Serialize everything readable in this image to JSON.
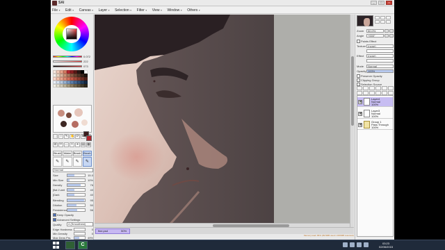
{
  "app": {
    "title": "SAI",
    "window_buttons": [
      "_",
      "□",
      "×"
    ]
  },
  "menubar": {
    "items": [
      "File",
      "Edit",
      "Canvas",
      "Layer",
      "Selection",
      "Filter",
      "View",
      "Window",
      "Others"
    ],
    "selection_label": "Selection",
    "zoom_value": "50%",
    "angle_value": "+000°",
    "stabilizer_label": "Stabilizer",
    "stabilizer_value": "7"
  },
  "color": {
    "hsv_values": [
      "0.072",
      "222",
      "073"
    ],
    "swatches": [
      "#f6e7df",
      "#f0c9b8",
      "#e8a48c",
      "#d57a62",
      "#b3262f",
      "#8a1f22",
      "#5a1a17",
      "#2b1614",
      "#000000",
      "#ffffff",
      "#f3efe8",
      "#e8d2c0",
      "#d9b39c",
      "#c99075",
      "#a9745b",
      "#8b5a44",
      "#6d4532",
      "#4f3426",
      "#362219",
      "#1d130e",
      "#f9d8cc",
      "#f3c0aa",
      "#eaa48d",
      "#df8a72",
      "#d3705c",
      "#c45a48",
      "#a94a3b",
      "#8c3b2e",
      "#6d2d23",
      "#4e2019",
      "#eaf0f7",
      "#d6e1ee",
      "#b9cbe0",
      "#98b1d0",
      "#7a97be",
      "#5d7ea9",
      "#476893",
      "#33527a",
      "#233e5f",
      "#152a44",
      "#f0eee6",
      "#e3ded0",
      "#d1c9b5",
      "#bcb299",
      "#a5987c",
      "#8d7e62",
      "#74674d",
      "#5c513b",
      "#443c2b",
      "#2e281c"
    ],
    "fg": "#3a1d1d",
    "bg": "#b3262f"
  },
  "tools": {
    "icons": [
      "⬚",
      "○",
      "✎",
      "✋",
      "⟳",
      "⊕",
      "✥",
      "⊘",
      "✂",
      "↔",
      "✧",
      "⌖",
      "▤",
      "▦"
    ],
    "brush_tabs": [
      "Brush",
      "Water",
      "Brush",
      "Brush"
    ],
    "brush_icons": [
      "✎",
      "✎",
      "✎",
      "✎"
    ]
  },
  "brush": {
    "mode": "Normal",
    "size_label": "Size",
    "size_mult": "x1.0",
    "size_value": "15.0",
    "min_size_label": "Min Size",
    "min_size_value": "10%",
    "density_label": "Density",
    "density_value": "76",
    "shape_label": "[flat 2.wet",
    "shape_value": "40",
    "texture_label": "[Dark",
    "texture_value": "40",
    "blending_label": "Blending",
    "blending_value": "95",
    "dilution_label": "Dilution",
    "dilution_value": "50",
    "persistence_label": "Persistence",
    "persistence_value": "56",
    "keep_opacity_label": "Keep Opacity",
    "advanced_label": "Advanced Settings",
    "quality_label": "Quality",
    "quality_value": "4 (Smoothest)",
    "edge_label": "Edge Hardness",
    "edge_value": "0",
    "min_density_label": "Min Density",
    "min_density_value": "0",
    "max_dens_label": "Max Dens Prs.",
    "max_dens_value": "49%",
    "hard_soft_label": "Hard <-> Soft",
    "hard_soft_value": "100"
  },
  "document": {
    "tab_label": "fine.psd",
    "tab_zoom": "50%"
  },
  "right": {
    "zoom_label": "Zoom",
    "zoom_value": "50.0%",
    "angle_label": "Angle",
    "angle_value": "+000°",
    "paint_effect": "Paints Effect",
    "texture_label": "Texture",
    "texture_value": "(none)",
    "effect_label": "Effect",
    "effect_value": "(none)",
    "mode_label": "Mode",
    "mode_value": "Normal",
    "opacity_label": "Opacity",
    "opacity_value": "100%",
    "preserve_opacity": "Preserve Opacity",
    "clipping_group": "Clipping Group",
    "selection_source": "Selection Source"
  },
  "layers": [
    {
      "name": "Layer4",
      "mode": "Normal",
      "opacity": "100%",
      "active": true,
      "folder": false
    },
    {
      "name": "Layer3",
      "mode": "Normal",
      "opacity": "100%",
      "active": false,
      "folder": false
    },
    {
      "name": "Group 1",
      "mode": "Pass Through",
      "opacity": "100%",
      "active": false,
      "folder": true
    }
  ],
  "status": {
    "memory": "Memory load: 86% (99.5MB used / 2156MB reserved)"
  },
  "taskbar": {
    "apps": [
      "",
      "C",
      "C"
    ],
    "time": "03:23",
    "date": "02/06/2015"
  }
}
